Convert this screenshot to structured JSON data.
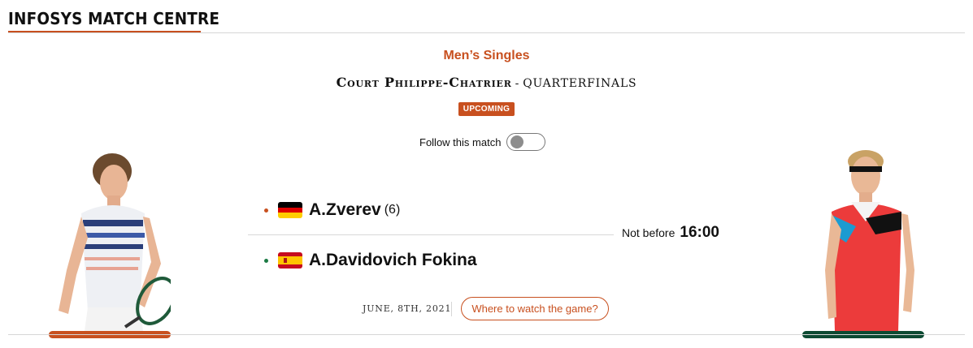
{
  "header": {
    "title": "INFOSYS MATCH CENTRE",
    "accent_color": "#c8501f"
  },
  "match": {
    "category": "Men’s Singles",
    "court_name": "Court Philippe-Chatrier",
    "separator": "-",
    "round": "QUARTERFINALS",
    "status": "UPCOMING",
    "follow_label": "Follow this match",
    "follow_enabled": false,
    "time_label": "Not before",
    "time_value": "16:00",
    "date": "JUNE, 8TH, 2021",
    "watch_label": "Where to watch the game?"
  },
  "players": [
    {
      "name": "A.Zverev",
      "seed": "(6)",
      "flag_icon": "germany-flag-icon",
      "dot_color": "#c8501f",
      "bar_color": "#c8501f"
    },
    {
      "name": "A.Davidovich Fokina",
      "seed": "",
      "flag_icon": "spain-flag-icon",
      "dot_color": "#1b7a44",
      "bar_color": "#0c4a32"
    }
  ]
}
